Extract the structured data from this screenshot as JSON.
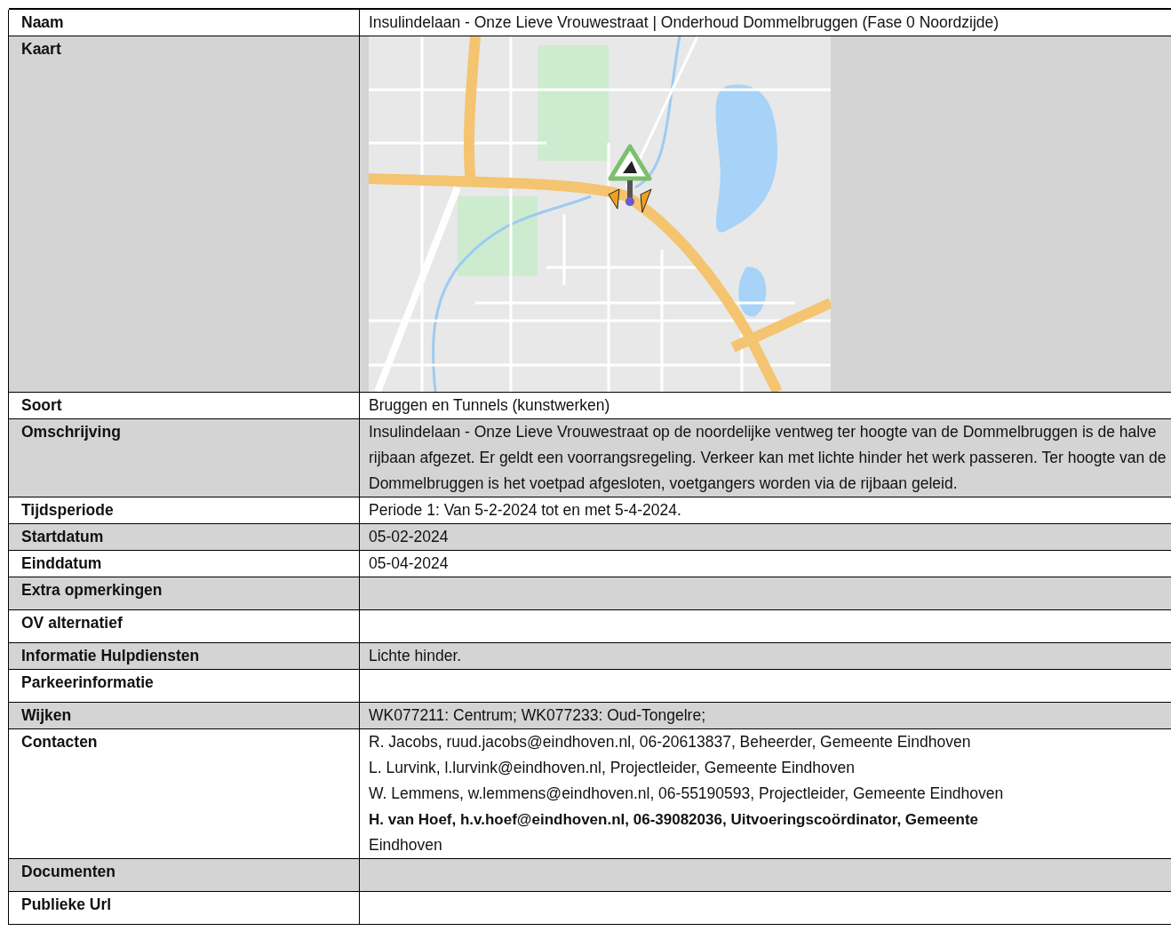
{
  "rows": [
    {
      "kind": "text",
      "label": "Naam",
      "value": "Insulindelaan - Onze Lieve Vrouwestraat | Onderhoud Dommelbruggen (Fase 0 Noordzijde)"
    },
    {
      "kind": "map",
      "label": "Kaart"
    },
    {
      "kind": "text",
      "label": "Soort",
      "value": "Bruggen en Tunnels (kunstwerken)"
    },
    {
      "kind": "text",
      "label": "Omschrijving",
      "value": "Insulindelaan - Onze Lieve Vrouwestraat op de noordelijke ventweg ter hoogte van de Dommelbruggen is de halve rijbaan afgezet. Er geldt een voorrangsregeling. Verkeer kan met lichte hinder het werk passeren. Ter hoogte van de Dommelbruggen is het voetpad afgesloten, voetgangers worden via de rijbaan geleid."
    },
    {
      "kind": "text",
      "label": "Tijdsperiode",
      "value": "Periode 1: Van 5-2-2024 tot en met 5-4-2024."
    },
    {
      "kind": "text",
      "label": "Startdatum",
      "value": "05-02-2024"
    },
    {
      "kind": "text",
      "label": "Einddatum",
      "value": "05-04-2024"
    },
    {
      "kind": "empty",
      "label": "Extra opmerkingen"
    },
    {
      "kind": "empty",
      "label": "OV alternatief"
    },
    {
      "kind": "text",
      "label": "Informatie Hulpdiensten",
      "value": "Lichte hinder."
    },
    {
      "kind": "empty",
      "label": "Parkeerinformatie"
    },
    {
      "kind": "text",
      "label": "Wijken",
      "value": "WK077211: Centrum; WK077233: Oud-Tongelre;"
    },
    {
      "kind": "lines",
      "label": "Contacten",
      "lines": [
        {
          "text": "R. Jacobs, ruud.jacobs@eindhoven.nl, 06-20613837, Beheerder, Gemeente Eindhoven",
          "bold": false
        },
        {
          "text": "L. Lurvink, l.lurvink@eindhoven.nl, Projectleider, Gemeente Eindhoven",
          "bold": false
        },
        {
          "text": "W. Lemmens, w.lemmens@eindhoven.nl, 06-55190593, Projectleider, Gemeente Eindhoven",
          "bold": false
        },
        {
          "text": "H. van Hoef, h.v.hoef@eindhoven.nl, 06-39082036, Uitvoeringscoördinator, Gemeente",
          "bold": true
        },
        {
          "text": "Eindhoven",
          "bold": false
        }
      ]
    },
    {
      "kind": "empty",
      "label": "Documenten"
    },
    {
      "kind": "empty",
      "label": "Publieke Url"
    }
  ]
}
